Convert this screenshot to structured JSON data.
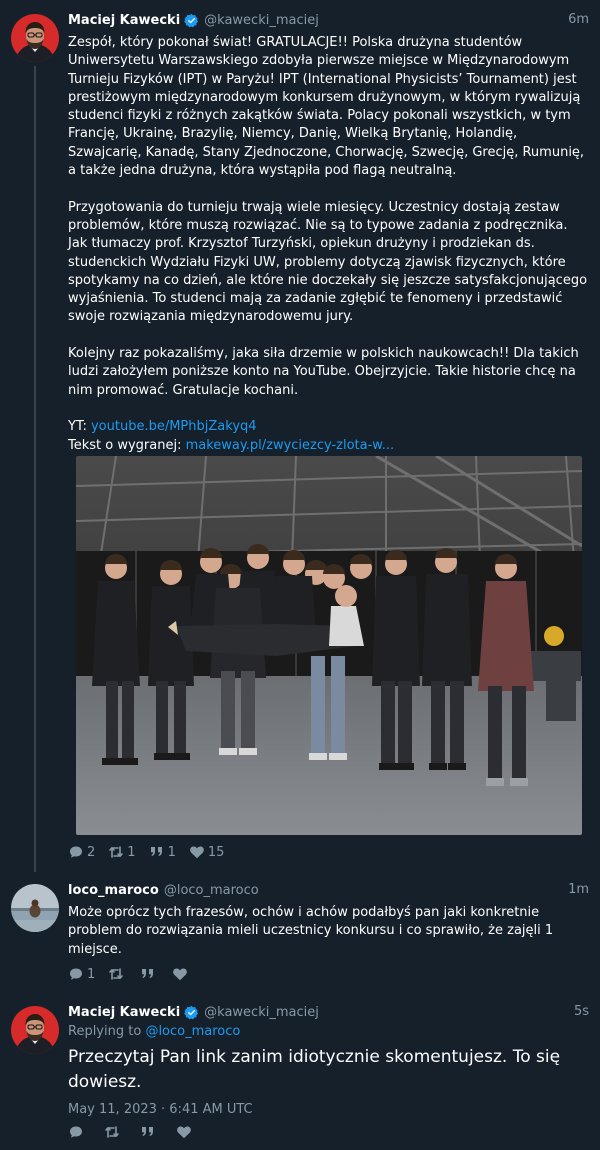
{
  "tweets": [
    {
      "author": "Maciej Kawecki",
      "handle": "@kawecki_maciej",
      "time": "6m",
      "paragraphs": [
        "Zespół, który pokonał świat! GRATULACJE!! Polska drużyna studentów Uniwersytetu Warszawskiego zdobyła pierwsze miejsce w Międzynarodowym Turnieju Fizyków (IPT) w Paryżu! IPT (International Physicists’ Tournament) jest prestiżowym międzynarodowym konkursem drużynowym, w którym rywalizują studenci fizyki z różnych zakątków świata. Polacy pokonali wszystkich, w tym Francję, Ukrainę, Brazylię, Niemcy, Danię, Wielką Brytanię, Holandię, Szwajcarię, Kanadę, Stany Zjednoczone, Chorwację, Szwecję, Grecję, Rumunię, a także jedna drużyna, która wystąpiła pod flagą neutralną.",
        "Przygotowania do turnieju trwają wiele miesięcy. Uczestnicy dostają zestaw problemów, które muszą rozwiązać. Nie są to typowe zadania z podręcznika. Jak tłumaczy prof. Krzysztof Turzyński, opiekun drużyny i prodziekan ds. studenckich Wydziału Fizyki UW, problemy dotyczą zjawisk fizycznych, które spotykamy na co dzień, ale które nie doczekały się jeszcze satysfakcjonującego wyjaśnienia. To studenci mają za zadanie zgłębić te fenomeny i przedstawić swoje rozwiązania międzynarodowemu jury.",
        "Kolejny raz pokazaliśmy, jaka siła drzemie w polskich naukowcach!! Dla takich ludzi założyłem poniższe konto na YouTube. Obejrzyjcie. Takie historie chcę na nim promować. Gratulacje kochani."
      ],
      "yt_label": "YT:",
      "yt_link": "youtube.be/MPhbjZakyq4",
      "text_label": "Tekst o wygranej:",
      "text_link": "makeway.pl/zwyciezcy-zlota-w...",
      "stats": {
        "replies": "2",
        "retweets": "1",
        "quotes": "1",
        "likes": "15"
      }
    },
    {
      "author": "loco_maroco",
      "handle": "@loco_maroco",
      "time": "1m",
      "text": "Może oprócz tych frazesów, ochów i achów podałbyś pan jaki konkretnie problem do rozwiązania mieli uczestnicy konkursu i co sprawiło, że zajęli 1 miejsce.",
      "stats": {
        "replies": "1"
      }
    },
    {
      "author": "Maciej Kawecki",
      "handle": "@kawecki_maciej",
      "time": "5s",
      "replying_label": "Replying to",
      "replying_to": "@loco_maroco",
      "text": "Przeczytaj Pan link zanim idiotycznie skomentujesz. To się dowiesz.",
      "date": "May 11, 2023 · 6:41 AM UTC"
    }
  ],
  "icons": [
    "verified-badge-icon",
    "reply-icon",
    "retweet-icon",
    "quote-icon",
    "like-icon"
  ],
  "colors": {
    "background": "#15202b",
    "link": "#1d9bf0",
    "muted": "#8899a6",
    "thread": "#38444d",
    "verified": "#1d9bf0"
  }
}
